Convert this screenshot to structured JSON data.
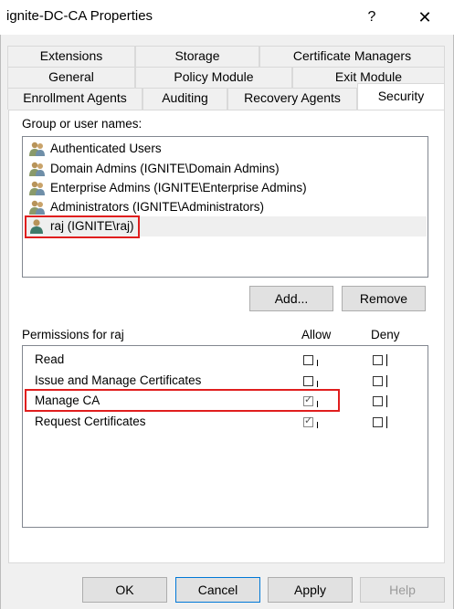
{
  "window": {
    "title": "ignite-DC-CA Properties",
    "help_glyph": "?",
    "close_glyph": "✕"
  },
  "tabs": {
    "row1": [
      "Extensions",
      "Storage",
      "Certificate Managers"
    ],
    "row2": [
      "General",
      "Policy Module",
      "Exit Module"
    ],
    "row3": [
      "Enrollment Agents",
      "Auditing",
      "Recovery Agents",
      "Security"
    ],
    "active": "Security"
  },
  "group_label": "Group or user names:",
  "users": [
    "Authenticated Users",
    "Domain Admins (IGNITE\\Domain Admins)",
    "Enterprise Admins (IGNITE\\Enterprise Admins)",
    "Administrators (IGNITE\\Administrators)",
    "raj (IGNITE\\raj)"
  ],
  "selected_user": "raj (IGNITE\\raj)",
  "buttons": {
    "add": "Add...",
    "remove": "Remove",
    "ok": "OK",
    "cancel": "Cancel",
    "apply": "Apply",
    "help": "Help"
  },
  "permissions": {
    "label": "Permissions for raj",
    "allow_header": "Allow",
    "deny_header": "Deny",
    "rows": [
      {
        "name": "Read",
        "allow": false,
        "deny": false
      },
      {
        "name": "Issue and Manage Certificates",
        "allow": false,
        "deny": false
      },
      {
        "name": "Manage CA",
        "allow": true,
        "deny": false
      },
      {
        "name": "Request Certificates",
        "allow": true,
        "deny": false
      }
    ]
  },
  "colors": {
    "highlight_box": "#e01e1e",
    "default_button_border": "#0078d7"
  }
}
